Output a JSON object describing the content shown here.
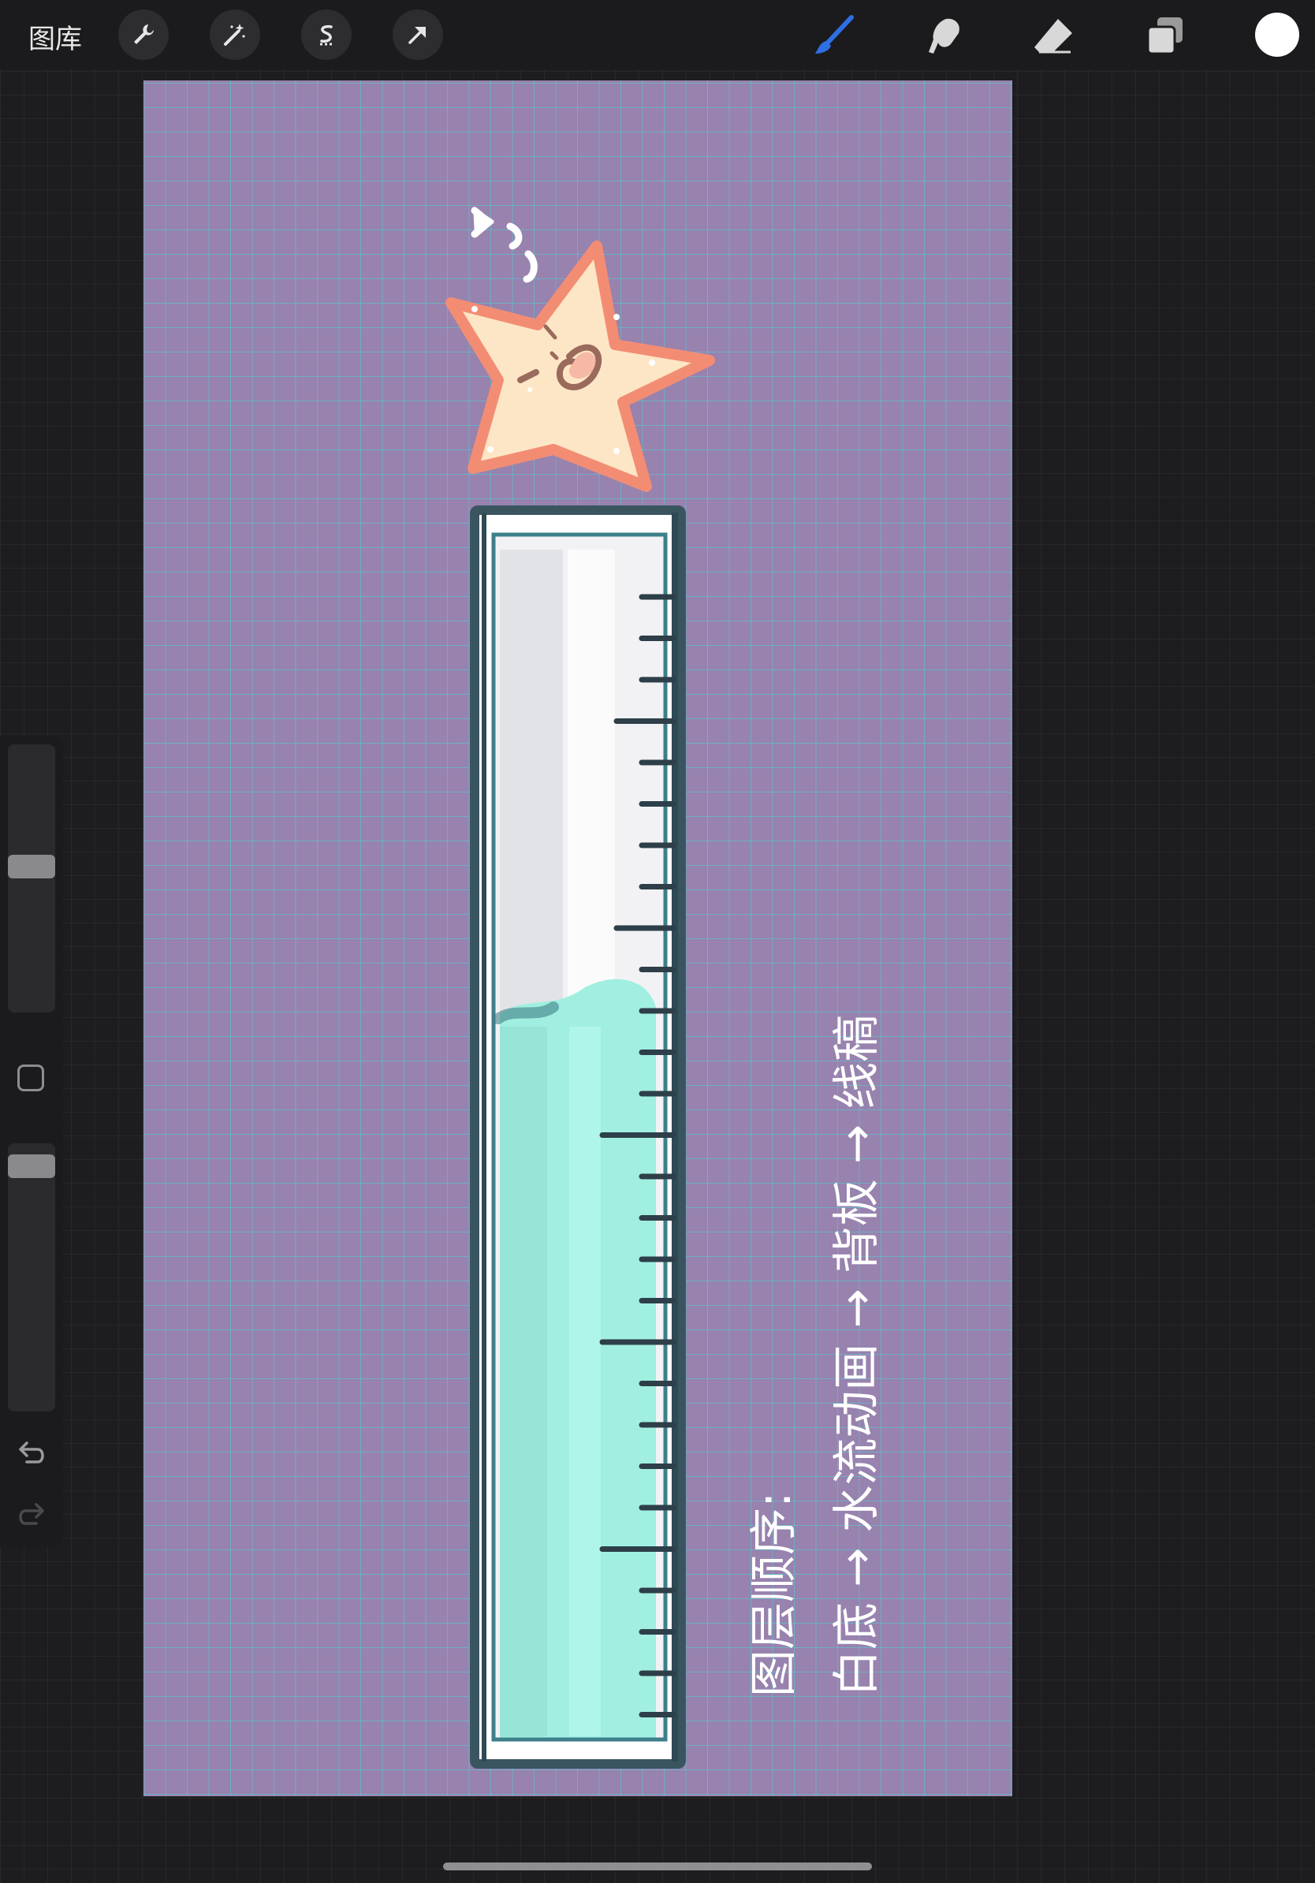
{
  "topbar": {
    "gallery_label": "图库",
    "left_tools": [
      "wrench-icon",
      "magic-wand-icon",
      "selection-icon",
      "transform-arrow-icon"
    ],
    "right_tools": [
      "brush-icon",
      "smudge-icon",
      "eraser-icon",
      "layers-icon",
      "color-swatch"
    ],
    "active_tool": "brush-icon",
    "accent_color": "#2f6fe4",
    "current_color": "#ffffff"
  },
  "canvas": {
    "background_color": "#9882ae",
    "grid_color": "#4cd2d6",
    "annotation": {
      "line1": "图层顺序:",
      "line2": "白底 → 水流动画 → 背板 → 线稿"
    }
  },
  "sidebar": {
    "brush_size_level": 0.55,
    "opacity_level": 0.05,
    "modify_button_icon": "square-outline-icon",
    "undo_icon": "undo-icon",
    "redo_icon": "redo-icon",
    "redo_enabled": false
  }
}
